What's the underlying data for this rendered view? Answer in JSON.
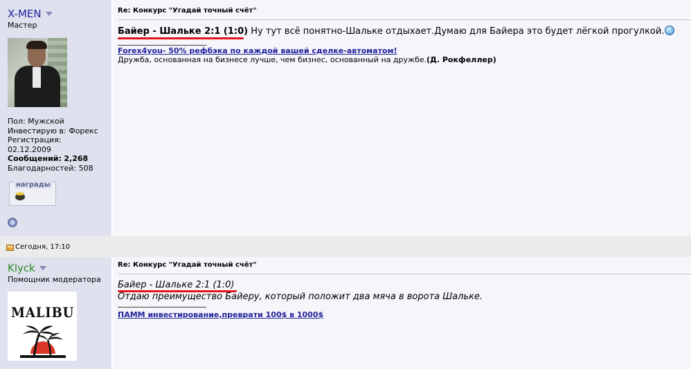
{
  "posts": [
    {
      "username": "X-MEN",
      "user_title": "Мастер",
      "info": {
        "gender": "Пол: Мужской",
        "invest": "Инвестирую в: Форекс",
        "reg_label": "Регистрация:",
        "reg_date": "02.12.2009",
        "messages_label": "Сообщений:",
        "messages_value": "2,268",
        "thanks": "Благодарностей: 508"
      },
      "awards_label": "награды",
      "title": "Re: Конкурс \"Угадай точный счёт\"",
      "message_bold": "Байер - Шальке 2:1 (1:0)",
      "message_text": " Ну тут всё понятно-Шальке отдыхает.Думаю для Байера это будет лёгкой прогулкой.",
      "sig_link": "Forex4you- 50% рефбэка по каждой вашей сделке-автоматом!",
      "sig_text": "Дружба, основанная на бизнесе лучше, чем бизнес, основанный на дружбе.",
      "sig_author": "(Д. Рокфеллер)"
    },
    {
      "date": "Сегодня, 17:10",
      "username": "Klyck",
      "user_title": "Помощник модератора",
      "avatar_text": "MALIBU",
      "title": "Re: Конкурс \"Угадай точный счёт\"",
      "quote": "Байер - Шальке 2:1 (1:0)",
      "message_text": "Отдаю преимущество Байеру, который положит два мяча в ворота Шальке.",
      "sig_link": "ПАММ инвестирование,преврати 100$ в 1000$"
    }
  ],
  "colors": {
    "sidebar_bg": "#dfe2ee",
    "link": "#22229c",
    "moderator_name": "#2a8a2a",
    "highlight_underline": "#e0141a"
  }
}
